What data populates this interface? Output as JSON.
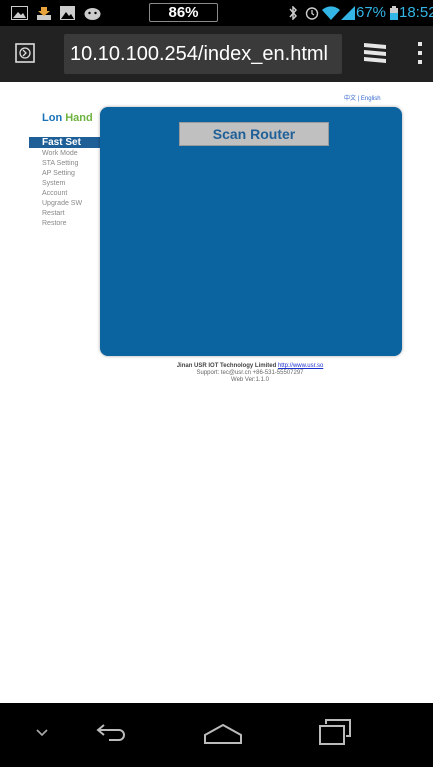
{
  "status_bar": {
    "battery_badge": "86%",
    "battery_level_text": "67%",
    "clock": "18:52",
    "icons": [
      "picture-icon",
      "download-icon",
      "image-icon",
      "android-icon",
      "bluetooth-icon",
      "alarm-icon",
      "wifi-icon",
      "signal-icon",
      "battery-icon"
    ],
    "accent_color": "#33b5e5"
  },
  "browser": {
    "url": "10.10.100.254/index_en.html",
    "icons": [
      "incognito-tab-icon",
      "tabs-icon",
      "overflow-menu-icon"
    ]
  },
  "page": {
    "lang_links": {
      "chinese": "中文",
      "separator": " | ",
      "english": "English"
    },
    "logo": {
      "part1": "Lon",
      "part2": "Hand"
    },
    "menu": [
      "Fast Set",
      "Work Mode",
      "STA Setting",
      "AP Setting",
      "System",
      "Account",
      "Upgrade SW",
      "Restart",
      "Restore"
    ],
    "active_menu_index": 0,
    "main_button": "Scan Router",
    "footer": {
      "company": "Jinan USR IOT Technology Limited",
      "website": "http://www.usr.so",
      "support": "Support: tec@usr.cn +86-531-55507297",
      "version": "Web Ver:1.1.0"
    },
    "colors": {
      "panel": "#0b639f",
      "menu_active": "#1e5f98",
      "logo_lon": "#1a73b8",
      "logo_hand": "#6db33f"
    }
  },
  "nav_bar": {
    "icons": [
      "hide-keyboard-chevron-icon",
      "back-icon",
      "home-icon",
      "recent-apps-icon"
    ]
  }
}
